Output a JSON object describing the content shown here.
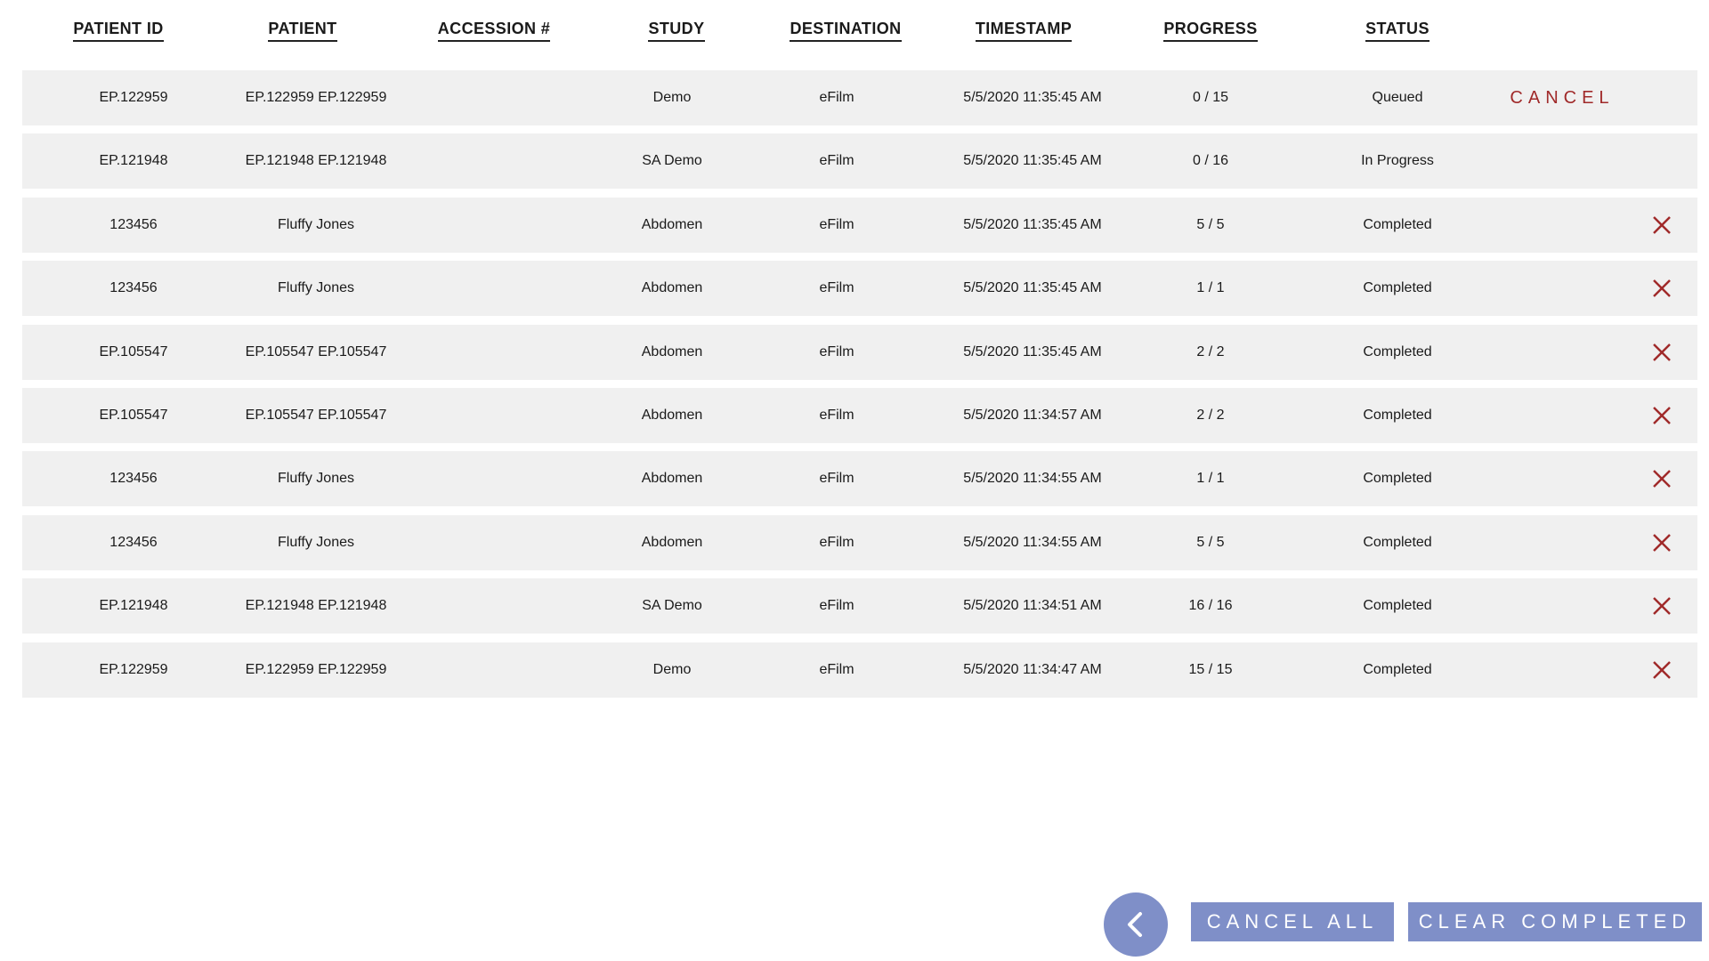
{
  "columns": [
    "PATIENT ID",
    "PATIENT",
    "ACCESSION #",
    "STUDY",
    "DESTINATION",
    "TIMESTAMP",
    "PROGRESS",
    "STATUS"
  ],
  "rows": [
    {
      "patient_id": "EP.122959",
      "patient": "EP.122959 EP.122959",
      "accession": "",
      "study": "Demo",
      "destination": "eFilm",
      "timestamp": "5/5/2020 11:35:45 AM",
      "progress": "0 / 15",
      "status": "Queued",
      "action": "CANCEL"
    },
    {
      "patient_id": "EP.121948",
      "patient": "EP.121948 EP.121948",
      "accession": "",
      "study": "SA Demo",
      "destination": "eFilm",
      "timestamp": "5/5/2020 11:35:45 AM",
      "progress": "0 / 16",
      "status": "In Progress",
      "action": ""
    },
    {
      "patient_id": "123456",
      "patient": "Fluffy Jones",
      "accession": "",
      "study": "Abdomen",
      "destination": "eFilm",
      "timestamp": "5/5/2020 11:35:45 AM",
      "progress": "5 / 5",
      "status": "Completed",
      "action": "remove"
    },
    {
      "patient_id": "123456",
      "patient": "Fluffy Jones",
      "accession": "",
      "study": "Abdomen",
      "destination": "eFilm",
      "timestamp": "5/5/2020 11:35:45 AM",
      "progress": "1 / 1",
      "status": "Completed",
      "action": "remove"
    },
    {
      "patient_id": "EP.105547",
      "patient": "EP.105547 EP.105547",
      "accession": "",
      "study": "Abdomen",
      "destination": "eFilm",
      "timestamp": "5/5/2020 11:35:45 AM",
      "progress": "2 / 2",
      "status": "Completed",
      "action": "remove"
    },
    {
      "patient_id": "EP.105547",
      "patient": "EP.105547 EP.105547",
      "accession": "",
      "study": "Abdomen",
      "destination": "eFilm",
      "timestamp": "5/5/2020 11:34:57 AM",
      "progress": "2 / 2",
      "status": "Completed",
      "action": "remove"
    },
    {
      "patient_id": "123456",
      "patient": "Fluffy Jones",
      "accession": "",
      "study": "Abdomen",
      "destination": "eFilm",
      "timestamp": "5/5/2020 11:34:55 AM",
      "progress": "1 / 1",
      "status": "Completed",
      "action": "remove"
    },
    {
      "patient_id": "123456",
      "patient": "Fluffy Jones",
      "accession": "",
      "study": "Abdomen",
      "destination": "eFilm",
      "timestamp": "5/5/2020 11:34:55 AM",
      "progress": "5 / 5",
      "status": "Completed",
      "action": "remove"
    },
    {
      "patient_id": "EP.121948",
      "patient": "EP.121948 EP.121948",
      "accession": "",
      "study": "SA Demo",
      "destination": "eFilm",
      "timestamp": "5/5/2020 11:34:51 AM",
      "progress": "16 / 16",
      "status": "Completed",
      "action": "remove"
    },
    {
      "patient_id": "EP.122959",
      "patient": "EP.122959 EP.122959",
      "accession": "",
      "study": "Demo",
      "destination": "eFilm",
      "timestamp": "5/5/2020 11:34:47 AM",
      "progress": "15 / 15",
      "status": "Completed",
      "action": "remove"
    }
  ],
  "footer": {
    "back_icon": "chevron-left-icon",
    "cancel_all_label": "CANCEL ALL",
    "clear_completed_label": "CLEAR COMPLETED"
  },
  "colors": {
    "row_bg": "#f0f0f0",
    "cancel_red": "#a02a2a",
    "button_blue": "#7f8fc8"
  },
  "icons": {
    "remove": "close-icon"
  }
}
